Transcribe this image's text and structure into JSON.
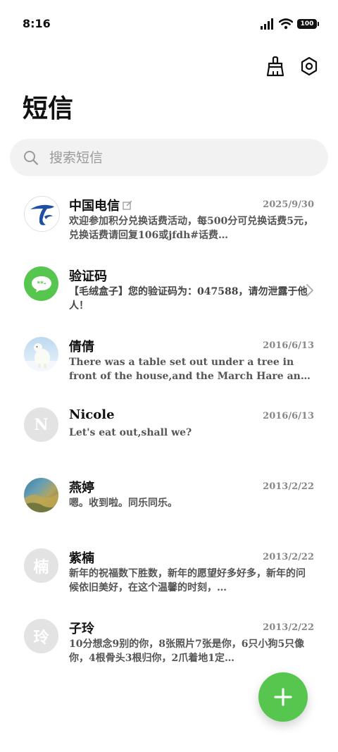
{
  "status": {
    "time": "8:16",
    "battery": "100"
  },
  "title": "短信",
  "search": {
    "placeholder": "搜索短信"
  },
  "messages": [
    {
      "name": "中国电信",
      "date": "2025/9/30",
      "preview": "欢迎参加积分兑换话费活动，每500分可兑换话费5元，兑换话费请回复106或jfdh#话费…",
      "avatar": "china-telecom-logo"
    },
    {
      "name": "验证码",
      "date": "",
      "preview": "【毛绒盒子】您的验证码为：047588，请勿泄露于他人！",
      "avatar": "message-bubble"
    },
    {
      "name": "倩倩",
      "date": "2016/6/13",
      "preview": "There was a table set out under a tree in front of the house,and the March Hare and the Ha…",
      "avatar": "polar-bear-photo"
    },
    {
      "name": "Nicole",
      "date": "2016/6/13",
      "preview": "Let's eat out,shall we?",
      "avatar_letter": "N"
    },
    {
      "name": "燕婷",
      "date": "2013/2/22",
      "preview": "嗯。收到啦。同乐同乐。",
      "avatar": "landscape-photo"
    },
    {
      "name": "紫楠",
      "date": "2013/2/22",
      "preview": "新年的祝福数下胜数，新年的愿望好多好多，新年的问候依旧美好，在这个温馨的时刻，…",
      "avatar_letter": "楠"
    },
    {
      "name": "子玲",
      "date": "2013/2/22",
      "preview": "10分想念9别的你，8张照片7张是你，6只小狗5只像你，4根骨头3根归你，2爪着地1定…",
      "avatar_letter": "玲"
    }
  ],
  "colors": {
    "accent": "#56c64f",
    "telecom_blue": "#1d4fa3",
    "search_bg": "#f2f2f2"
  }
}
